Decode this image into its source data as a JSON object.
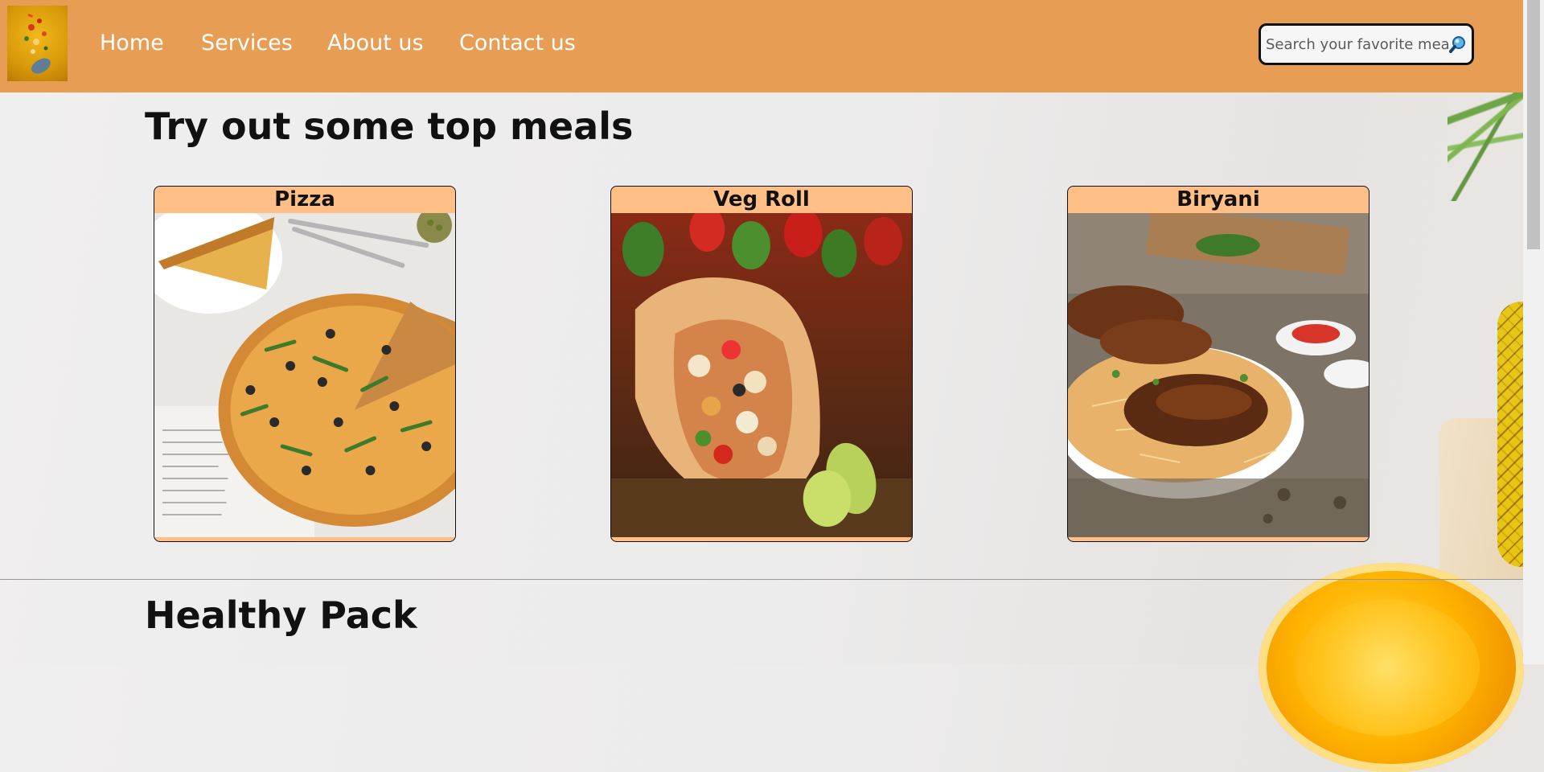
{
  "nav": {
    "logo_icon": "flying-food-logo",
    "links": [
      "Home",
      "Services",
      "About us",
      "Contact us"
    ]
  },
  "search": {
    "placeholder": "Search your favorite meal",
    "icon": "search-icon"
  },
  "sections": {
    "top_meals_title": "Try out some top meals",
    "healthy_pack_title": "Healthy Pack"
  },
  "meals": [
    {
      "name": "Pizza",
      "image": "pizza-photo"
    },
    {
      "name": "Veg Roll",
      "image": "veg-roll-photo"
    },
    {
      "name": "Biryani",
      "image": "biryani-photo"
    }
  ],
  "colors": {
    "header": "#e79d54",
    "card_header": "#ffbf87",
    "text": "#111111"
  }
}
